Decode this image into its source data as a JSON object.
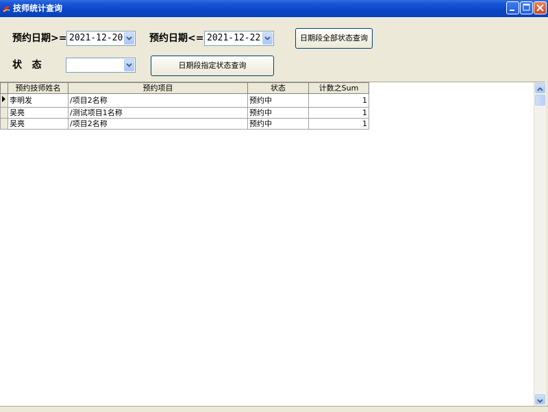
{
  "window": {
    "title": "技师统计查询",
    "icon": "app-logo-icon",
    "controls": [
      "minimize-icon",
      "maximize-icon",
      "close-icon"
    ]
  },
  "filters": {
    "date_from_label": "预约日期>=",
    "date_from_value": "2021-12-20",
    "date_to_label": "预约日期<=",
    "date_to_value": "2021-12-22",
    "status_label": "状   态",
    "status_value": ""
  },
  "buttons": {
    "query_all_status": "日期段全部状态查询",
    "query_specified_status": "日期段指定状态查询"
  },
  "table": {
    "columns": [
      "预约技师姓名",
      "预约项目",
      "状态",
      "计数之Sum"
    ],
    "rows": [
      [
        "李明发",
        "/项目2名称",
        "预约中",
        "1"
      ],
      [
        "吴亮",
        "/测试项目1名称",
        "预约中",
        "1"
      ],
      [
        "吴亮",
        "/项目2名称",
        "预约中",
        "1"
      ]
    ],
    "selected_row": 0
  },
  "colors": {
    "titlebar": "#0a46c8",
    "window_bg": "#ece9d8",
    "close_button": "#c9442a"
  }
}
